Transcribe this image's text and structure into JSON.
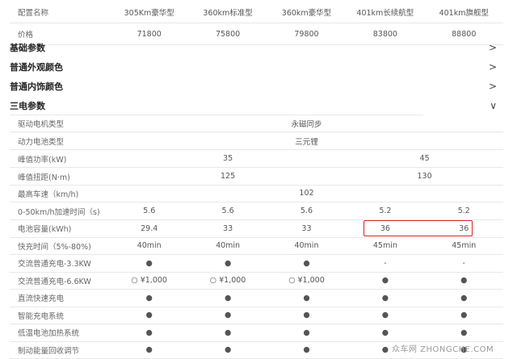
{
  "header": {
    "label": "配置名称",
    "models": [
      "305Km豪华型",
      "360km标准型",
      "360km豪华型",
      "401km长续航型",
      "401km旗舰型"
    ]
  },
  "price": {
    "label": "价格",
    "values": [
      "71800",
      "75800",
      "79800",
      "83800",
      "88800"
    ]
  },
  "sections": [
    {
      "label": "基础参数",
      "icon": "chevron-right"
    },
    {
      "label": "普通外观颜色",
      "icon": "chevron-right"
    },
    {
      "label": "普通内饰颜色",
      "icon": "chevron-right"
    },
    {
      "label": "三电参数",
      "icon": "chevron-down"
    }
  ],
  "chev_right": ">",
  "chev_down": "∨",
  "rows": {
    "motor": {
      "label": "驱动电机类型",
      "value": "永磁同步"
    },
    "battery_type": {
      "label": "动力电池类型",
      "value": "三元锂"
    },
    "power": {
      "label": "峰值功率(kW)",
      "a": "35",
      "b": "45"
    },
    "torque": {
      "label": "峰值扭距(N·m)",
      "a": "125",
      "b": "130"
    },
    "speed": {
      "label": "最高车速（km/h)",
      "value": "102"
    },
    "accel": {
      "label": "0-50km/h加速时间（s)",
      "values": [
        "5.6",
        "5.6",
        "5.6",
        "5.2",
        "5.2"
      ]
    },
    "capacity": {
      "label": "电池容量(kWh)",
      "values": [
        "29.4",
        "33",
        "33",
        "36",
        "36"
      ]
    },
    "fast": {
      "label": "快充时间（5%-80%)",
      "values": [
        "40min",
        "40min",
        "40min",
        "45min",
        "45min"
      ]
    },
    "ac33": {
      "label": "交流普通充电-3.3KW",
      "values": [
        "●",
        "●",
        "●",
        "-",
        "-"
      ]
    },
    "ac66": {
      "label": "交流普通充电-6.6KW",
      "values": [
        "○ ¥1,000",
        "○ ¥1,000",
        "○ ¥1,000",
        "●",
        "●"
      ]
    },
    "dc": {
      "label": "直流快速充电",
      "values": [
        "●",
        "●",
        "●",
        "●",
        "●"
      ]
    },
    "smart": {
      "label": "智能充电系统",
      "values": [
        "●",
        "●",
        "●",
        "●",
        "●"
      ]
    },
    "heat": {
      "label": "低温电池加热系统",
      "values": [
        "●",
        "●",
        "●",
        "●",
        "●"
      ]
    },
    "regen": {
      "label": "制动能量回收调节",
      "values": [
        "●",
        "●",
        "●",
        "●",
        "●"
      ]
    }
  },
  "watermark": "众车网 ZHONGCHE.COM"
}
